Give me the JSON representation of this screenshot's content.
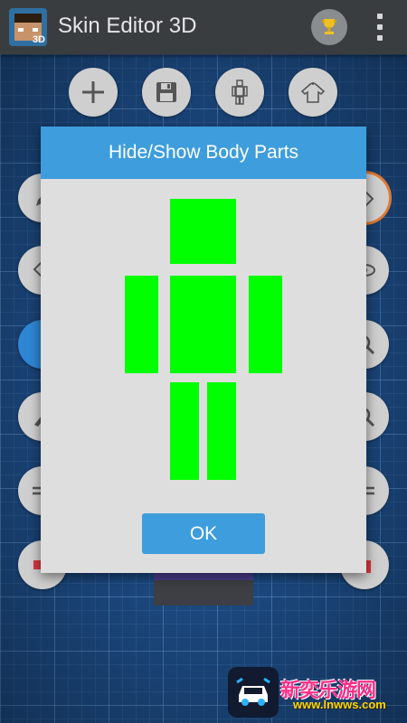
{
  "app": {
    "title": "Skin Editor 3D",
    "logo_badge": "3D",
    "icons": {
      "trophy": "trophy-icon",
      "menu": "overflow-menu-icon"
    }
  },
  "toolbar": {
    "buttons": [
      {
        "name": "new-skin-button",
        "icon": "plus-icon"
      },
      {
        "name": "save-button",
        "icon": "floppy-disk-icon"
      },
      {
        "name": "body-parts-button",
        "icon": "figure-icon"
      },
      {
        "name": "clothing-button",
        "icon": "shirt-icon"
      }
    ]
  },
  "dialog": {
    "title": "Hide/Show Body Parts",
    "ok_label": "OK",
    "parts": [
      {
        "name": "head",
        "visible": true
      },
      {
        "name": "body",
        "visible": true
      },
      {
        "name": "left-arm",
        "visible": true
      },
      {
        "name": "right-arm",
        "visible": true
      },
      {
        "name": "left-leg",
        "visible": true
      },
      {
        "name": "right-leg",
        "visible": true
      }
    ]
  },
  "watermark": {
    "text": "新奕乐游网",
    "url": "www.lnwws.com"
  },
  "colors": {
    "accent": "#3e9ddc",
    "part_visible": "#00ff00",
    "dialog_bg": "#dedede",
    "appbar": "#3a3d40"
  }
}
